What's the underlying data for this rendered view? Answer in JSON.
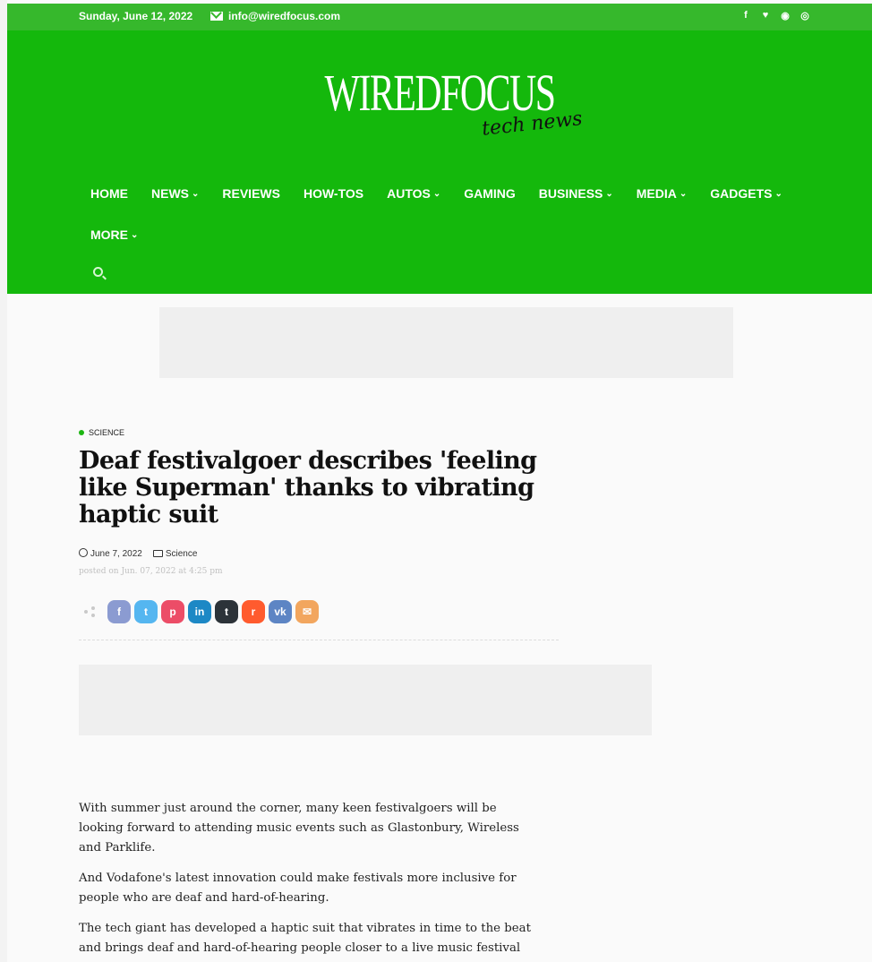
{
  "topbar": {
    "date": "Sunday, June 12, 2022",
    "email": "info@wiredfocus.com",
    "social": [
      {
        "name": "facebook-icon",
        "glyph": "f"
      },
      {
        "name": "twitter-icon",
        "glyph": "♥"
      },
      {
        "name": "pinterest-icon",
        "glyph": "◉"
      },
      {
        "name": "instagram-icon",
        "glyph": "◎"
      }
    ]
  },
  "logo": {
    "main": "WIREDFOCUS",
    "sub": "tech news"
  },
  "nav": [
    {
      "label": "HOME",
      "dropdown": false
    },
    {
      "label": "NEWS",
      "dropdown": true
    },
    {
      "label": "REVIEWS",
      "dropdown": false
    },
    {
      "label": "HOW-TOS",
      "dropdown": false
    },
    {
      "label": "AUTOS",
      "dropdown": true
    },
    {
      "label": "GAMING",
      "dropdown": false
    },
    {
      "label": "BUSINESS",
      "dropdown": true
    },
    {
      "label": "MEDIA",
      "dropdown": true
    },
    {
      "label": "GADGETS",
      "dropdown": true
    },
    {
      "label": "MORE",
      "dropdown": true
    }
  ],
  "article": {
    "category": "SCIENCE",
    "title": "Deaf festivalgoer describes 'feeling like Superman' thanks to vibrating haptic suit",
    "date": "June 7, 2022",
    "meta_category": "Science",
    "posted": "posted on Jun. 07, 2022 at 4:25 pm",
    "share_buttons": [
      {
        "name": "facebook-share-button",
        "glyph": "f",
        "color": "#8b9bd1"
      },
      {
        "name": "twitter-share-button",
        "glyph": "t",
        "color": "#55b6f0"
      },
      {
        "name": "pinterest-share-button",
        "glyph": "p",
        "color": "#ec4d67"
      },
      {
        "name": "linkedin-share-button",
        "glyph": "in",
        "color": "#1d88c5"
      },
      {
        "name": "tumblr-share-button",
        "glyph": "t",
        "color": "#2c3339"
      },
      {
        "name": "reddit-share-button",
        "glyph": "r",
        "color": "#ff5b2e"
      },
      {
        "name": "vk-share-button",
        "glyph": "vk",
        "color": "#5d85c4"
      },
      {
        "name": "email-share-button",
        "glyph": "✉",
        "color": "#f2a65e"
      }
    ],
    "paragraphs": [
      "With summer just around the corner, many keen festivalgoers will be looking forward to attending music events such as Glastonbury, Wireless and Parklife.",
      "And Vodafone's latest innovation could make festivals more inclusive for people who are deaf and hard-of-hearing.",
      "The tech giant has developed a haptic suit that vibrates in time to the beat and brings deaf and hard-of-hearing people closer to a live music festival"
    ]
  },
  "colors": {
    "header_green": "#14b80c",
    "topbar_green": "#36b82c",
    "accent_dot": "#1db512"
  }
}
